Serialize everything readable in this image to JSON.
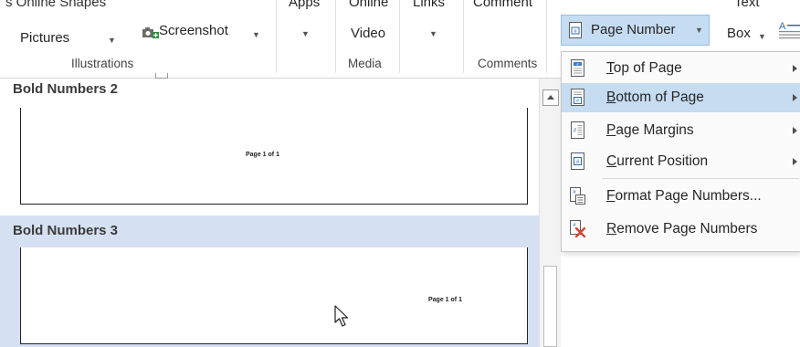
{
  "ribbon": {
    "cut_top_left": "s  Online  Shapes",
    "pictures": "Pictures",
    "screenshot": "Screenshot",
    "cut_apps": "Apps",
    "online": "Online",
    "video": "Video",
    "cut_links": "Links",
    "cut_comment": "Comment",
    "page_number": "Page Number",
    "cut_text": "Text",
    "box": "Box",
    "groups": {
      "illustrations": "Illustrations",
      "media": "Media",
      "comments": "Comments"
    }
  },
  "gallery": {
    "items": [
      {
        "title": "Bold Numbers 2",
        "page_text": "Page 1 of 1",
        "selected": false
      },
      {
        "title": "Bold Numbers 3",
        "page_text": "Page 1 of 1",
        "selected": true
      }
    ]
  },
  "menu": {
    "items": [
      {
        "pre": "",
        "key": "T",
        "post": "op of Page",
        "submenu": true,
        "icon": "top-of-page-icon"
      },
      {
        "pre": "",
        "key": "B",
        "post": "ottom of Page",
        "submenu": true,
        "icon": "bottom-of-page-icon",
        "active": true
      },
      {
        "pre": "",
        "key": "P",
        "post": "age Margins",
        "submenu": true,
        "icon": "page-margins-icon"
      },
      {
        "pre": "",
        "key": "C",
        "post": "urrent Position",
        "submenu": true,
        "icon": "current-position-icon"
      },
      {
        "pre": "",
        "key": "F",
        "post": "ormat Page Numbers...",
        "submenu": false,
        "icon": "format-page-numbers-icon"
      },
      {
        "pre": "",
        "key": "R",
        "post": "emove Page Numbers",
        "submenu": false,
        "icon": "remove-page-numbers-icon"
      }
    ]
  },
  "colors": {
    "highlight": "#c6dcf1",
    "button_active": "#c5dcf2",
    "remove_x": "#d9432f"
  }
}
